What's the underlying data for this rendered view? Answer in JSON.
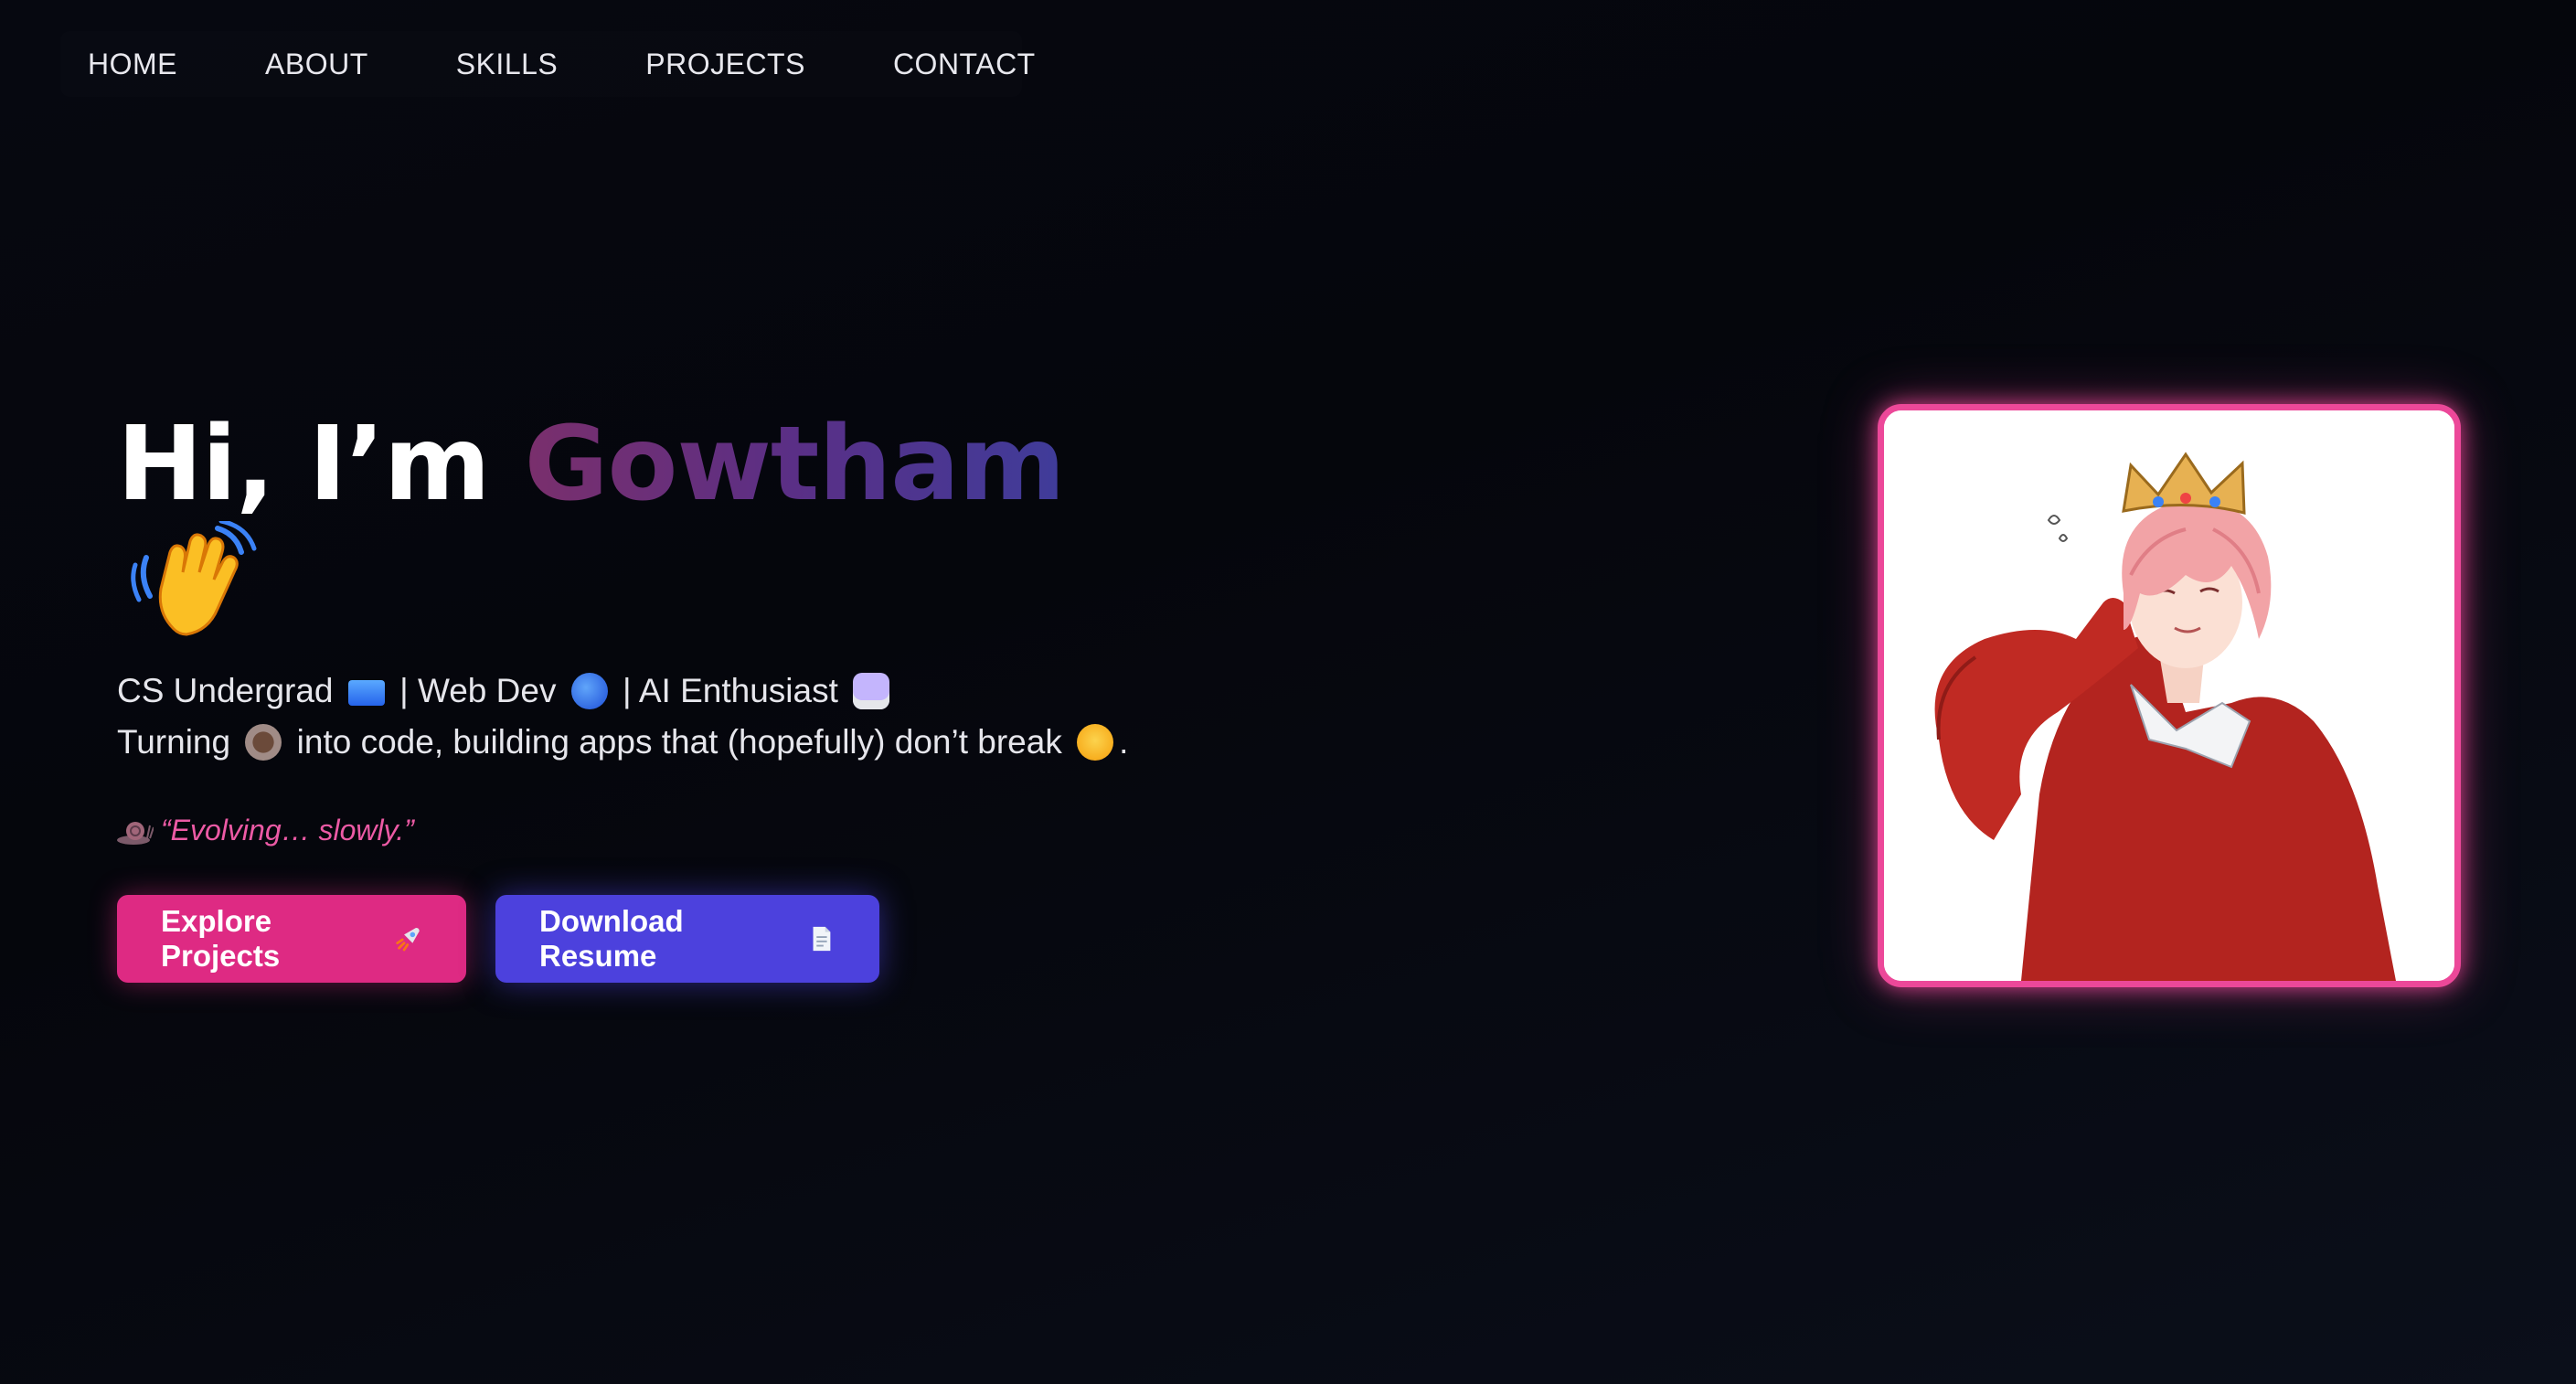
{
  "nav": {
    "items": [
      {
        "label": "HOME"
      },
      {
        "label": "ABOUT"
      },
      {
        "label": "SKILLS"
      },
      {
        "label": "PROJECTS"
      },
      {
        "label": "CONTACT"
      }
    ]
  },
  "hero": {
    "greeting": "Hi, I’m ",
    "name": "Gowtham",
    "greeting_emoji": "waving-hand",
    "tagline": {
      "part1": "CS Undergrad",
      "part2": " | Web Dev",
      "part3": " | AI Enthusiast",
      "line2_part1": "Turning",
      "line2_part2": " into code, building apps that (hopefully) don’t break",
      "line2_end": "."
    },
    "quote": "“Evolving… slowly.”",
    "buttons": {
      "primary": "Explore Projects",
      "secondary": "Download Resume"
    }
  },
  "profile": {
    "image": "anime-character-with-crown-avatar"
  },
  "colors": {
    "accent_pink": "#ec4899",
    "button_pink": "#de2a83",
    "button_indigo": "#4c41dd",
    "quote_pink": "#ec5aa5",
    "name_gradient": [
      "#7a2f6c",
      "#5a2f86",
      "#3f3c9a"
    ]
  }
}
